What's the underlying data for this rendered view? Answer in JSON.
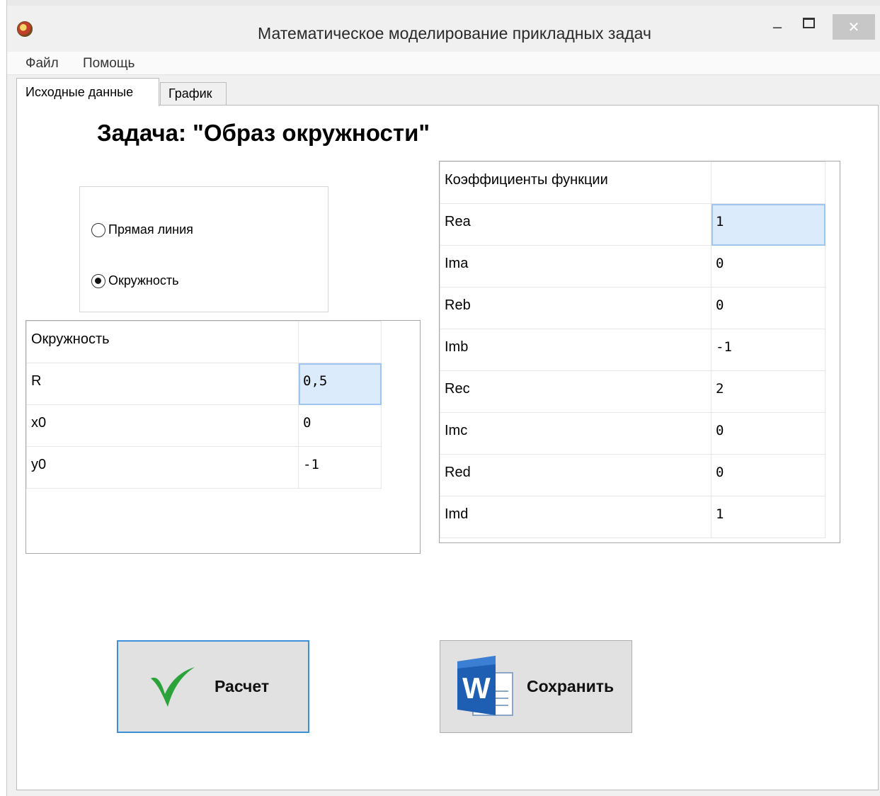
{
  "window": {
    "title": "Математическое моделирование прикладных задач",
    "min_glyph": "–",
    "close_glyph": "✕"
  },
  "menu": [
    {
      "label": "Файл"
    },
    {
      "label": "Помощь"
    }
  ],
  "tabs": [
    {
      "label": "Исходные данные",
      "active": true
    },
    {
      "label": "График",
      "active": false
    }
  ],
  "task_title": "Задача: \"Образ окружности\"",
  "shape_options": [
    {
      "label": "Прямая линия",
      "checked": false
    },
    {
      "label": "Окружность",
      "checked": true
    }
  ],
  "circle_grid": {
    "header": "Окружность",
    "rows": [
      {
        "name": "R",
        "value": "0,5",
        "selected": true
      },
      {
        "name": "x0",
        "value": "0"
      },
      {
        "name": "y0",
        "value": "-1"
      }
    ]
  },
  "coef_grid": {
    "header": "Коэффициенты функции",
    "rows": [
      {
        "name": "Rea",
        "value": "1",
        "selected": true
      },
      {
        "name": "Ima",
        "value": "0"
      },
      {
        "name": "Reb",
        "value": "0"
      },
      {
        "name": "Imb",
        "value": "-1"
      },
      {
        "name": "Rec",
        "value": "2"
      },
      {
        "name": "Imc",
        "value": "0"
      },
      {
        "name": "Red",
        "value": "0"
      },
      {
        "name": "Imd",
        "value": "1"
      }
    ]
  },
  "buttons": {
    "calc_label": "Расчет",
    "save_label": "Сохранить"
  },
  "colors": {
    "check_green": "#2ca33a",
    "word_blue": "#1e5fb3",
    "selection": "#dcebfb"
  }
}
